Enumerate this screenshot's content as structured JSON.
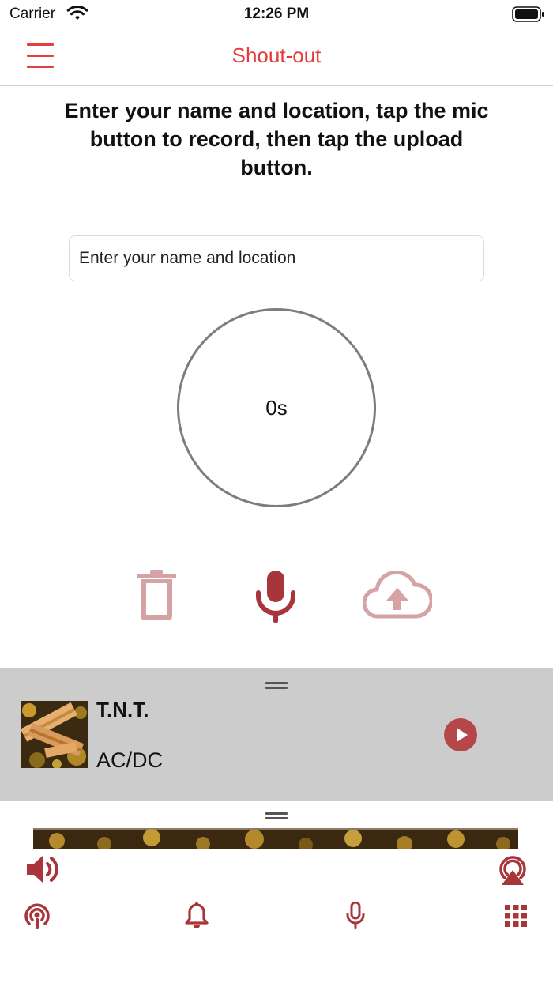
{
  "status_bar": {
    "carrier": "Carrier",
    "time": "12:26 PM"
  },
  "nav": {
    "title": "Shout-out",
    "menu_icon": "hamburger-menu-icon"
  },
  "instruction": "Enter your name and location, tap the mic button to record, then tap the upload button.",
  "name_input": {
    "placeholder": "Enter your name and location",
    "value": ""
  },
  "recorder": {
    "elapsed": "0s"
  },
  "actions": {
    "delete_icon": "trash-icon",
    "record_icon": "microphone-icon",
    "upload_icon": "cloud-upload-icon"
  },
  "now_playing": {
    "title": "T.N.T.",
    "artist": "AC/DC",
    "play_icon": "play-icon"
  },
  "bottom_icons": {
    "volume": "volume-icon",
    "airplay": "airplay-icon",
    "podcast": "podcast-icon",
    "notifications": "bell-icon",
    "mic": "microphone-icon",
    "grid": "grid-icon"
  },
  "colors": {
    "accent": "#e43a3a",
    "icon_dark_red": "#a8353a",
    "icon_faded_red": "#d6a3a5",
    "panel_gray": "#cccccc"
  }
}
